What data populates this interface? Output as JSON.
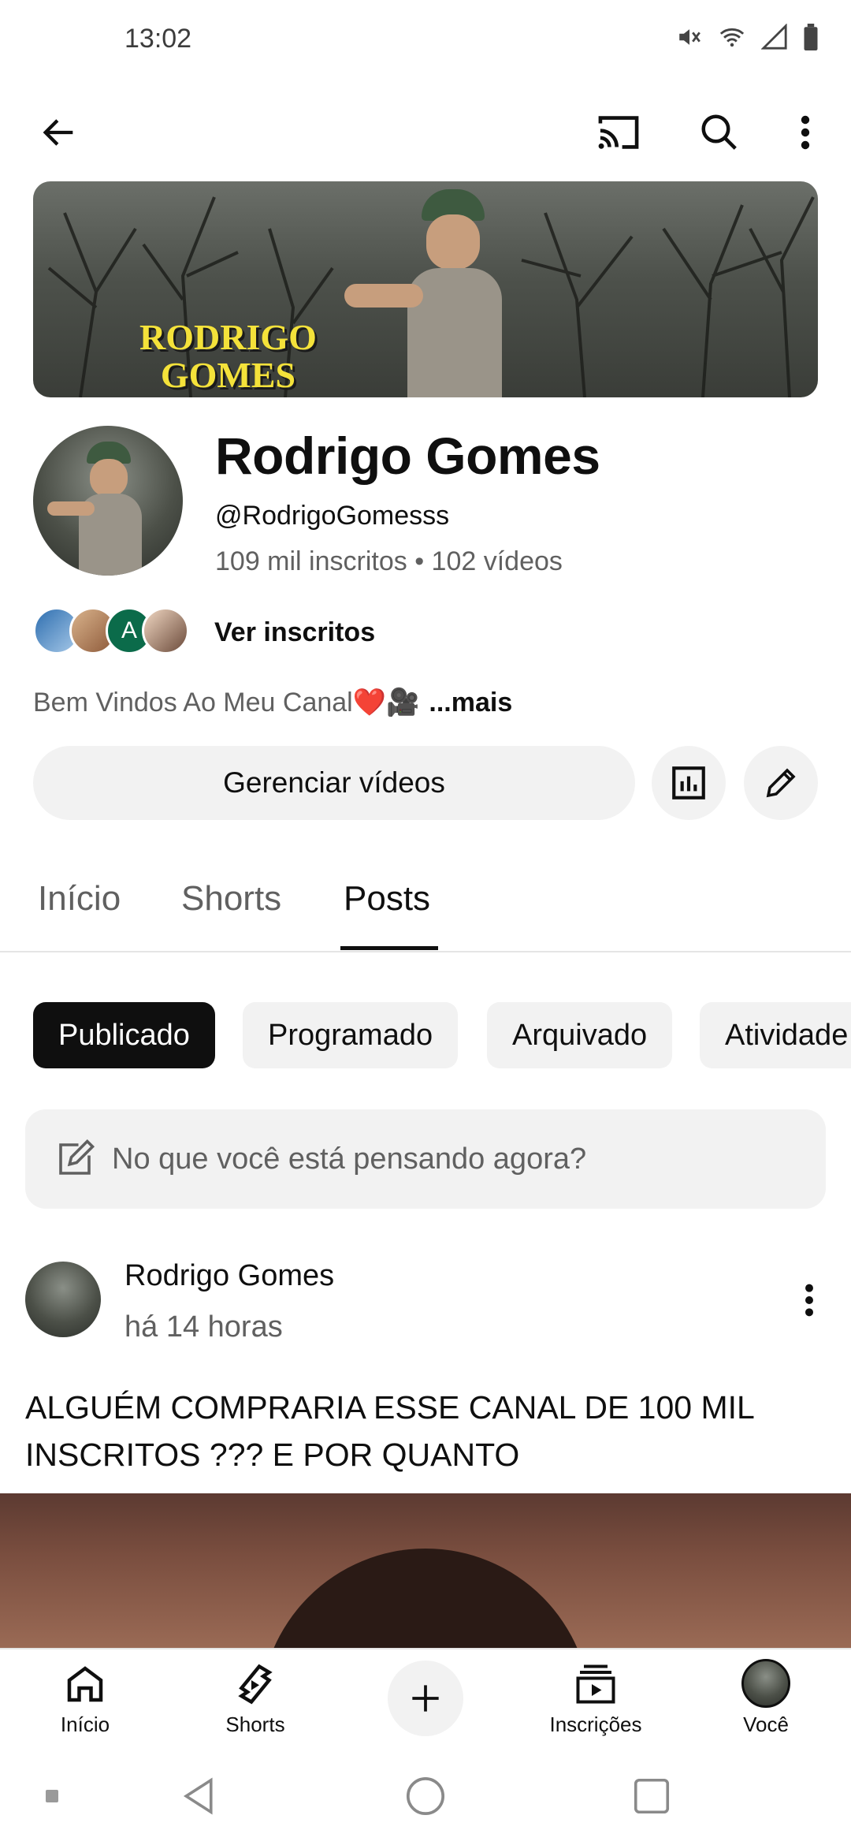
{
  "status_bar": {
    "time": "13:02"
  },
  "channel": {
    "banner_text_line1": "RODRIGO",
    "banner_text_line2": "GOMES",
    "name": "Rodrigo Gomes",
    "handle": "@RodrigoGomesss",
    "stats": "109 mil inscritos • 102 vídeos",
    "subscribers_link": "Ver inscritos",
    "subscriber_avatar_letter": "A",
    "bio": "Bem Vindos Ao Meu Canal❤️🎥",
    "bio_more": "...mais",
    "manage_button": "Gerenciar vídeos"
  },
  "tabs": [
    {
      "label": "Início"
    },
    {
      "label": "Shorts"
    },
    {
      "label": "Posts"
    }
  ],
  "chips": [
    {
      "label": "Publicado"
    },
    {
      "label": "Programado"
    },
    {
      "label": "Arquivado"
    },
    {
      "label": "Atividade"
    }
  ],
  "composer": {
    "placeholder": "No que você está pensando agora?"
  },
  "post": {
    "author": "Rodrigo Gomes",
    "time": "há 14 horas",
    "text": "ALGUÉM COMPRARIA ESSE CANAL DE 100 MIL INSCRITOS ??? E POR QUANTO"
  },
  "bottom_nav": [
    {
      "label": "Início"
    },
    {
      "label": "Shorts"
    },
    {
      "label": ""
    },
    {
      "label": "Inscrições"
    },
    {
      "label": "Você"
    }
  ],
  "colors": {
    "active_chip": "#0f0f0f",
    "chip_bg": "#f2f2f2",
    "secondary_text": "#606060"
  }
}
